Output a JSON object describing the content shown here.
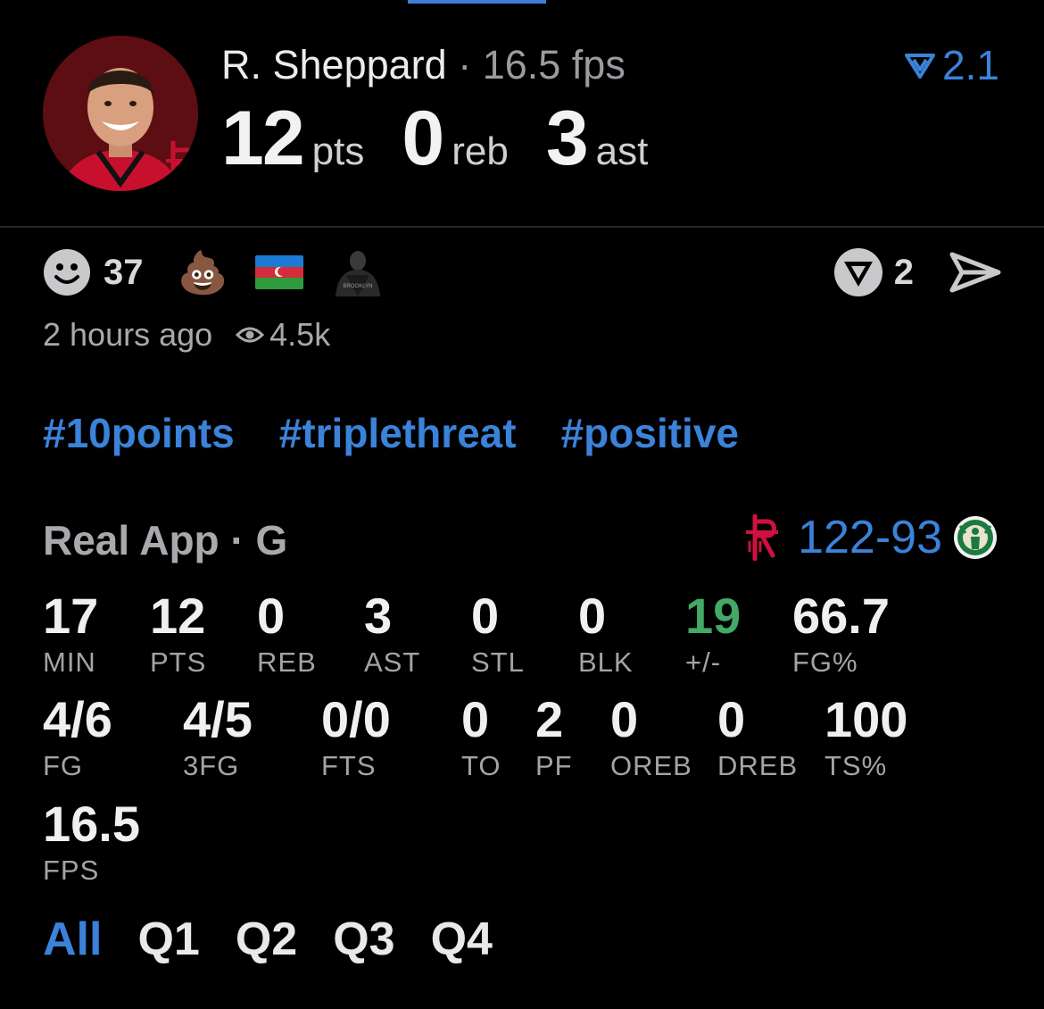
{
  "player": {
    "name": "R. Sheppard",
    "separator": "·",
    "fps_label": "16.5 fps",
    "score_delta": "2.1"
  },
  "headline": {
    "pts_value": "12",
    "pts_unit": "pts",
    "reb_value": "0",
    "reb_unit": "reb",
    "ast_value": "3",
    "ast_unit": "ast"
  },
  "reactions": {
    "smile_count": "37",
    "poop_emoji": "💩",
    "votes": "2",
    "icons": [
      "smile-icon",
      "poop-emoji",
      "azerbaijan-flag",
      "brooklyn-player-avatar",
      "vote-icon",
      "send-icon"
    ]
  },
  "meta": {
    "time_ago": "2 hours ago",
    "views": "4.5k"
  },
  "tags": [
    "#10points",
    "#triplethreat",
    "#positive"
  ],
  "game": {
    "source": "Real App · G",
    "score_home": "122",
    "score_dash": "-",
    "score_away": "93"
  },
  "stats_row1": [
    {
      "value": "17",
      "label": "MIN"
    },
    {
      "value": "12",
      "label": "PTS"
    },
    {
      "value": "0",
      "label": "REB"
    },
    {
      "value": "3",
      "label": "AST"
    },
    {
      "value": "0",
      "label": "STL"
    },
    {
      "value": "0",
      "label": "BLK"
    },
    {
      "value": "19",
      "label": "+/-"
    },
    {
      "value": "66.7",
      "label": "FG%"
    }
  ],
  "stats_row2": [
    {
      "value": "4/6",
      "label": "FG"
    },
    {
      "value": "4/5",
      "label": "3FG"
    },
    {
      "value": "0/0",
      "label": "FTS"
    },
    {
      "value": "0",
      "label": "TO"
    },
    {
      "value": "2",
      "label": "PF"
    },
    {
      "value": "0",
      "label": "OREB"
    },
    {
      "value": "0",
      "label": "DREB"
    },
    {
      "value": "100",
      "label": "TS%"
    }
  ],
  "stats_row3": [
    {
      "value": "16.5",
      "label": "FPS"
    }
  ],
  "quarters": [
    "All",
    "Q1",
    "Q2",
    "Q3",
    "Q4"
  ],
  "colors": {
    "accent": "#3b82d9",
    "positive": "#44a866",
    "background": "#000000"
  }
}
